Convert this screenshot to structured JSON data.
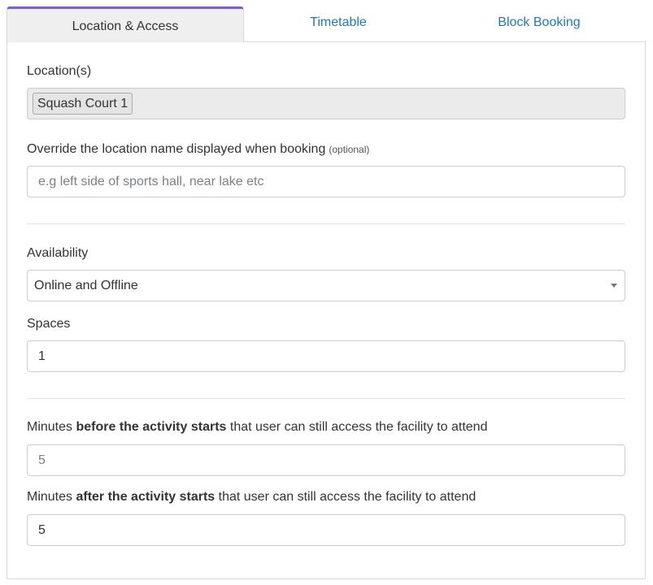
{
  "tabs": [
    {
      "label": "Location & Access",
      "active": true
    },
    {
      "label": "Timetable",
      "active": false
    },
    {
      "label": "Block Booking",
      "active": false
    }
  ],
  "colors": {
    "accent": "#7b5be6",
    "link": "#1a7bbf"
  },
  "locations": {
    "label": "Location(s)",
    "selected": [
      "Squash Court 1"
    ]
  },
  "override": {
    "label": "Override the location name displayed when booking",
    "optional_note": "(optional)",
    "value": "",
    "placeholder": "e.g left side of sports hall, near lake etc"
  },
  "availability": {
    "label": "Availability",
    "selected": "Online and Offline",
    "icon": "chevron-down-icon"
  },
  "spaces": {
    "label": "Spaces",
    "value": "1"
  },
  "minutes_before": {
    "label_prefix": "Minutes ",
    "label_bold": "before the activity starts",
    "label_suffix": " that user can still access the facility to attend",
    "value": "5"
  },
  "minutes_after": {
    "label_prefix": "Minutes ",
    "label_bold": "after the activity starts",
    "label_suffix": " that user can still access the facility to attend",
    "value": "5"
  }
}
